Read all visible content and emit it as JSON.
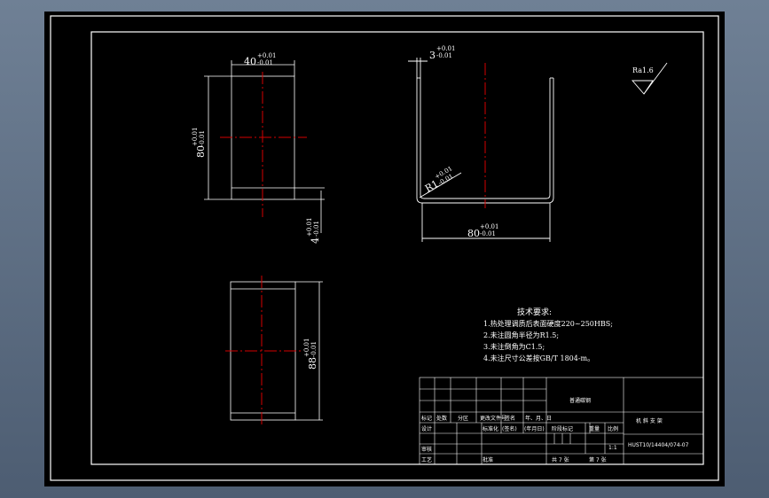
{
  "colors": {
    "background": "#000000",
    "lines": "#ffffff",
    "centerline": "#d40000",
    "frame": "#5a6b80"
  },
  "view_front": {
    "width_nominal": "40",
    "width_tol_upper": "+0.01",
    "width_tol_lower": "-0.01",
    "height_nominal": "80",
    "height_tol_upper": "+0.01",
    "height_tol_lower": "-0.01",
    "thick_nominal": "4",
    "thick_tol_upper": "+0.01",
    "thick_tol_lower": "-0.01"
  },
  "view_side": {
    "thick_nominal": "3",
    "thick_tol_upper": "+0.01",
    "thick_tol_lower": "-0.01",
    "radius_nominal": "R1",
    "radius_tol_upper": "+0.01",
    "radius_tol_lower": "-0.01",
    "width_nominal": "80",
    "width_tol_upper": "+0.01",
    "width_tol_lower": "-0.01"
  },
  "view_top": {
    "len_nominal": "88",
    "len_tol_upper": "+0.01",
    "len_tol_lower": "-0.01"
  },
  "roughness": "Ra1.6",
  "tech_requirements": {
    "title": "技术要求:",
    "items": [
      "1.热处理调质后表面硬度220~250HBS;",
      "2.未注圆角半径为R1.5;",
      "3.未注倒角为C1.5;",
      "4.未注尺寸公差按GB/T 1804-m。"
    ]
  },
  "title_block": {
    "labels": [
      "标记",
      "处数",
      "分区",
      "更改文件号",
      "签名",
      "年、月、日"
    ],
    "design": "设计",
    "standardize": "标准化",
    "signature": "(签名)",
    "date": "(年月日)",
    "review": "审核",
    "process": "工艺",
    "approve": "批准",
    "stage": "阶段标记",
    "weight": "重量",
    "scale": "比例",
    "scale_value": "1:1",
    "sheets_total": "共 7 张",
    "sheets_num": "第 7 张",
    "material": "普通碳钢",
    "part_name": "机 斜 支 架",
    "drawing_no": "HUST10/14404/074-07"
  }
}
